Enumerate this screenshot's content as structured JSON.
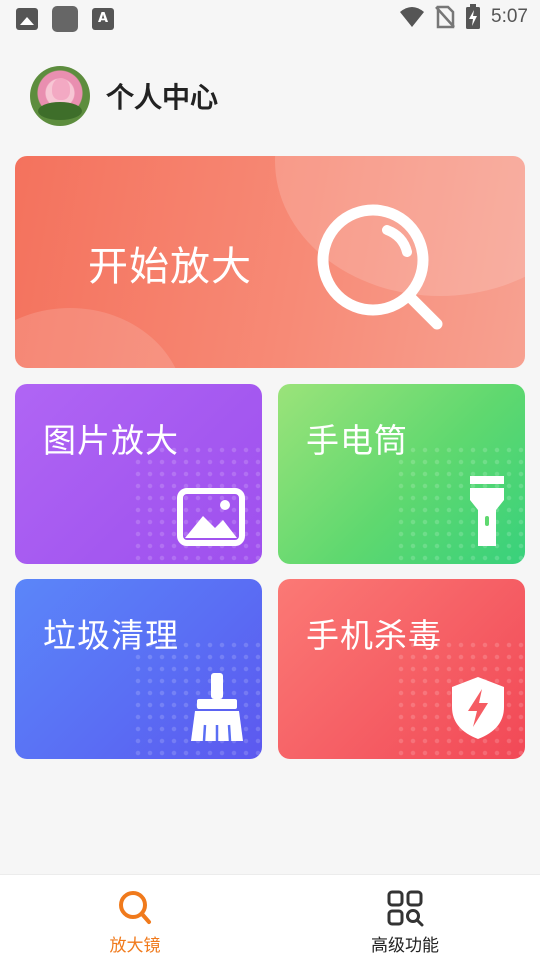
{
  "status_bar": {
    "time": "5:07",
    "icons": [
      "image-notification-icon",
      "app-notification-icon",
      "font-notification-icon",
      "wifi-icon",
      "no-sim-icon",
      "battery-charging-icon"
    ]
  },
  "header": {
    "title": "个人中心",
    "avatar": "lotus-avatar"
  },
  "hero": {
    "label": "开始放大",
    "icon": "magnifier-icon",
    "color": "#f4725d"
  },
  "cards": [
    {
      "label": "图片放大",
      "icon": "image-icon",
      "color": "#a458f0"
    },
    {
      "label": "手电筒",
      "icon": "flashlight-icon",
      "color": "#5fd86f"
    },
    {
      "label": "垃圾清理",
      "icon": "broom-icon",
      "color": "#5a6ef4"
    },
    {
      "label": "手机杀毒",
      "icon": "shield-bolt-icon",
      "color": "#f55c63"
    }
  ],
  "bottom_nav": {
    "tabs": [
      {
        "label": "放大镜",
        "icon": "search-icon",
        "active": true
      },
      {
        "label": "高级功能",
        "icon": "grid-search-icon",
        "active": false
      }
    ],
    "active_color": "#f07a1c"
  }
}
